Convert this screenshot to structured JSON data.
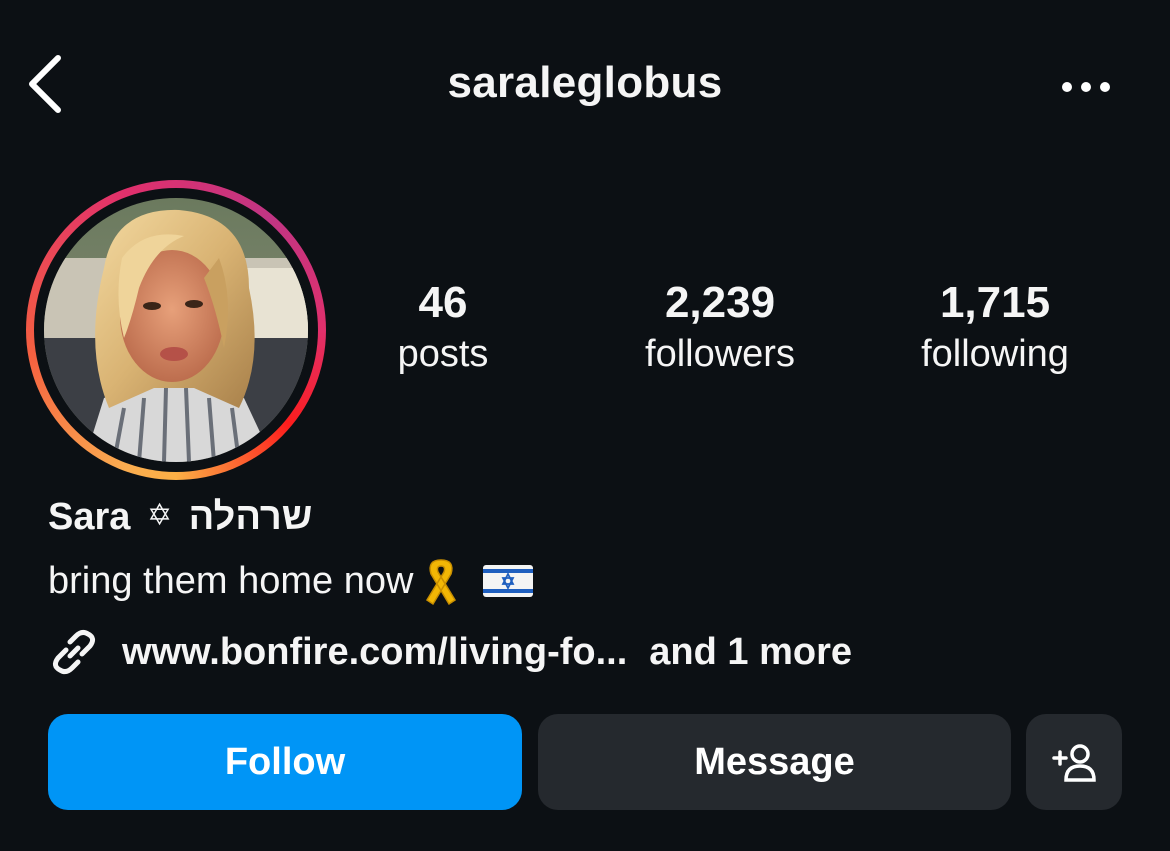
{
  "header": {
    "username": "saraleglobus",
    "back_icon": "chevron-left-icon",
    "more_icon": "more-horizontal-icon"
  },
  "profile": {
    "avatar": "profile-photo",
    "stats": [
      {
        "value": "46",
        "label": "posts"
      },
      {
        "value": "2,239",
        "label": "followers"
      },
      {
        "value": "1,715",
        "label": "following"
      }
    ],
    "name_latin": "Sara",
    "name_symbol": "✡",
    "name_hebrew": "שרהלה",
    "bio_text": "bring them home now",
    "bio_emoji_1": "yellow-ribbon",
    "bio_emoji_2": "israel-flag",
    "link_text": "www.bonfire.com/living-fo...",
    "link_more": "and 1 more",
    "link_icon": "link-icon"
  },
  "actions": {
    "follow_label": "Follow",
    "message_label": "Message",
    "add_icon": "add-person-icon"
  },
  "colors": {
    "background": "#0c1014",
    "follow_button": "#0095f6",
    "secondary_button": "#25292e"
  }
}
